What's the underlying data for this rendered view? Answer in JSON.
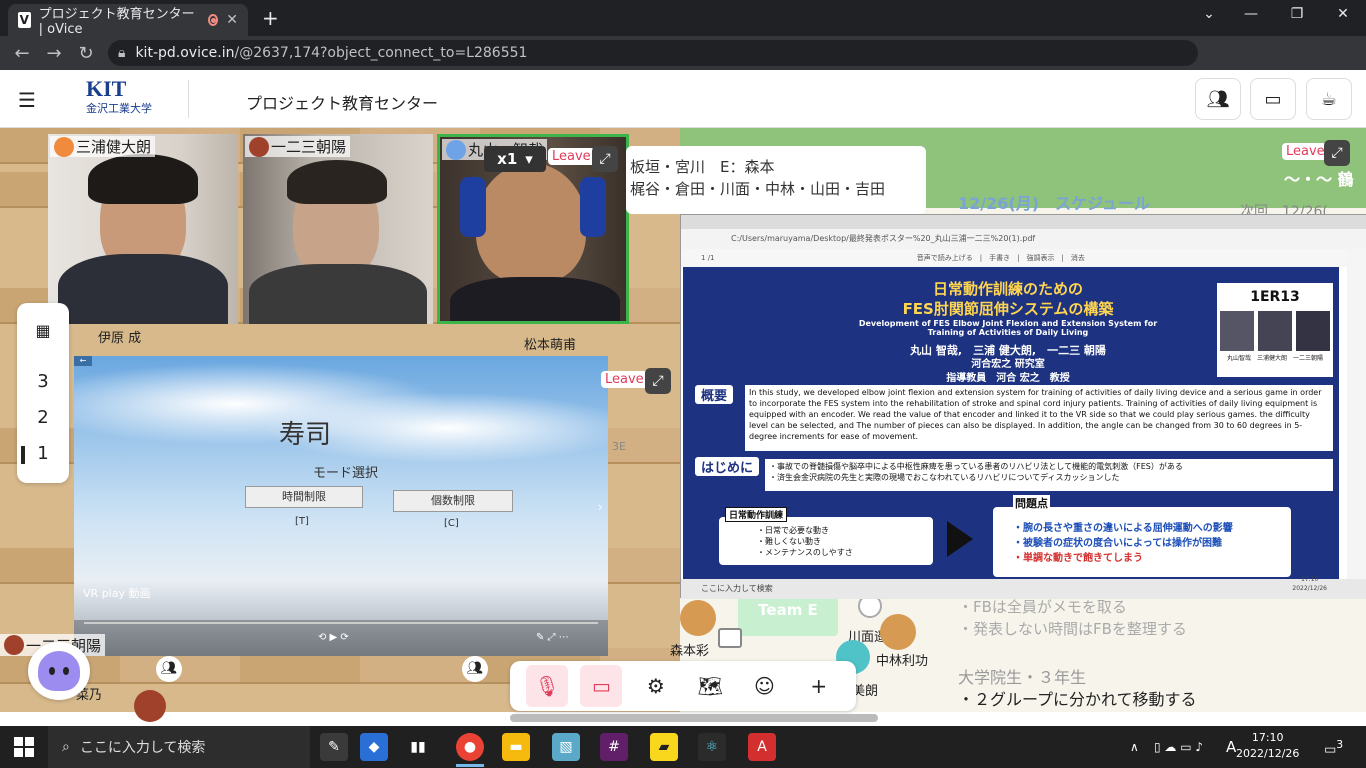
{
  "browser": {
    "tab_title": "プロジェクト教育センター | oVice",
    "favicon": "V",
    "url_host": "kit-pd.ovice.in",
    "url_path": "/@2637,174?object_connect_to=L286551"
  },
  "header": {
    "logo_text": "KIT",
    "logo_sub": "金沢工業大学",
    "space_title": "プロジェクト教育センター"
  },
  "videos": [
    {
      "name": "三浦健大朗"
    },
    {
      "name": "一二三朝陽"
    },
    {
      "name": "丸山　智哉"
    }
  ],
  "speed": "x1",
  "leave_label": "Leave",
  "announcement": {
    "line1": "板垣・宮川　E：森本",
    "line2": "梶谷・倉田・川面・中林・山田・吉田"
  },
  "floors": [
    "3",
    "2",
    "1"
  ],
  "map_labels": {
    "ihara": "伊原 成",
    "matsumoto": "松本萌甫",
    "hifumi_bottom": "一二三朝陽",
    "team_e": "Team E",
    "morimoto": "森本彩",
    "kawamo": "川面遥奈",
    "nakabayashi": "中林利功",
    "kuni": "菜乃",
    "miyo": "美朗",
    "code_3e": "3E"
  },
  "vr_video": {
    "title": "寿司",
    "subtitle": "モード選択",
    "btn_time": "時間制限",
    "btn_count": "個数制限",
    "key_time": "[T]",
    "key_count": "[C]",
    "label": "VR play 動画"
  },
  "schedule": {
    "title": "12/26(月)　スケジュール",
    "next": "次回　12/26(",
    "heading_partial": "～・～ 鶴",
    "notes": [
      "・FBは全員がメモを取る",
      "・発表しない時間はFBを整理する"
    ],
    "group": "大学院生・３年生",
    "move": "・２グループに分かれて移動する"
  },
  "poster": {
    "title1": "日常動作訓練のための",
    "title2": "FES肘関節屈伸システムの構築",
    "subtitle": "Development of FES Elbow Joint Flexion and Extension System for Training of Activities of Daily Living",
    "authors": "丸山 智哉,　三浦 健大朗,　一二三 朝陽",
    "lab": "河合宏之 研究室",
    "advisor": "指導教員　河合 宏之　教授",
    "id": "1ER13",
    "photo_caption": "丸山智哉　三浦健大朗　一二三朝陽",
    "h_overview": "概要",
    "overview": "In this study, we developed elbow joint flexion and extension system for training of activities of daily living device and a serious game in order to incorporate the FES system into the rehabilitation of stroke and spinal cord injury patients. Training of activities of daily living equipment is equipped with an encoder. We read the value of that encoder and linked it to the VR side so that we could play serious games. the difficulty level can be selected, and The number of pieces can also be displayed. In addition, the angle can be changed from 30 to 60 degrees in 5-degree increments for ease of movement.",
    "h_intro": "はじめに",
    "intro1": "・事故での脊髄損傷や脳卒中による中枢性麻痺を患っている患者のリハビリ法として機能的電気刺激（FES）がある",
    "intro2": "・済生会金沢病院の先生と実際の現場でおこなわれているリハビリについてディスカッションした",
    "h_daily": "日常動作訓練",
    "daily": [
      "・日常で必要な動き",
      "・難しくない動き",
      "・メンテナンスのしやすさ"
    ],
    "h_problem": "問題点",
    "problem1": "・腕の長さや重さの違いによる屈伸運動への影響",
    "problem2": "・被験者の症状の度合いによっては操作が困難",
    "problem3": "・単調な動きで飽きてしまう"
  },
  "share_browser": {
    "path": "C:/Users/maruyama/Desktop/最終発表ポスター%20_丸山三浦一二三%20(1).pdf",
    "page": "1",
    "pages": "/1",
    "toolbar": "音声で読み上げる　|　手書き　|　強調表示　|　消去",
    "taskbar_search": "ここに入力して検索",
    "time": "17:10",
    "date": "2022/12/26"
  },
  "taskbar": {
    "search": "ここに入力して検索",
    "time": "17:10",
    "date": "2022/12/26",
    "ime": "A",
    "notif": "3"
  },
  "colors": {
    "accent": "#1d3281",
    "leave": "#e23c5a",
    "active_border": "#3cb44a"
  }
}
